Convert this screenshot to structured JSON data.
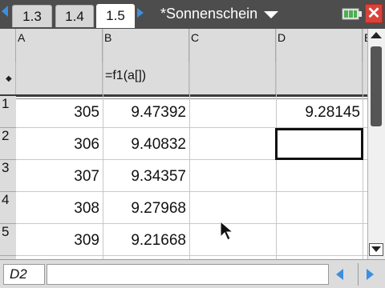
{
  "tabs": [
    {
      "label": "1.3",
      "active": false
    },
    {
      "label": "1.4",
      "active": false
    },
    {
      "label": "1.5",
      "active": true
    }
  ],
  "document": {
    "title": "*Sonnenschein"
  },
  "sheet": {
    "columns": [
      "A",
      "B",
      "C",
      "D",
      "E"
    ],
    "formula_row": {
      "marker": "◆",
      "b": "=f1(a[])"
    },
    "rows": [
      {
        "num": "1",
        "a": "305",
        "b": "9.47392",
        "d": "9.28145"
      },
      {
        "num": "2",
        "a": "306",
        "b": "9.40832",
        "d": ""
      },
      {
        "num": "3",
        "a": "307",
        "b": "9.34357",
        "d": ""
      },
      {
        "num": "4",
        "a": "308",
        "b": "9.27968",
        "d": ""
      },
      {
        "num": "5",
        "a": "309",
        "b": "9.21668",
        "d": ""
      }
    ],
    "selected_cell": "D2"
  },
  "entry": {
    "cell_ref": "D2",
    "value": ""
  },
  "icons": {
    "tab_left": "triangle-left-icon",
    "tab_right": "triangle-right-icon",
    "battery": "battery-icon",
    "close": "close-icon",
    "pointer": "mouse-pointer-icon"
  },
  "colors": {
    "accent": "#3c8fe0",
    "header_bar": "#4d4d4d",
    "close": "#d9433a"
  }
}
